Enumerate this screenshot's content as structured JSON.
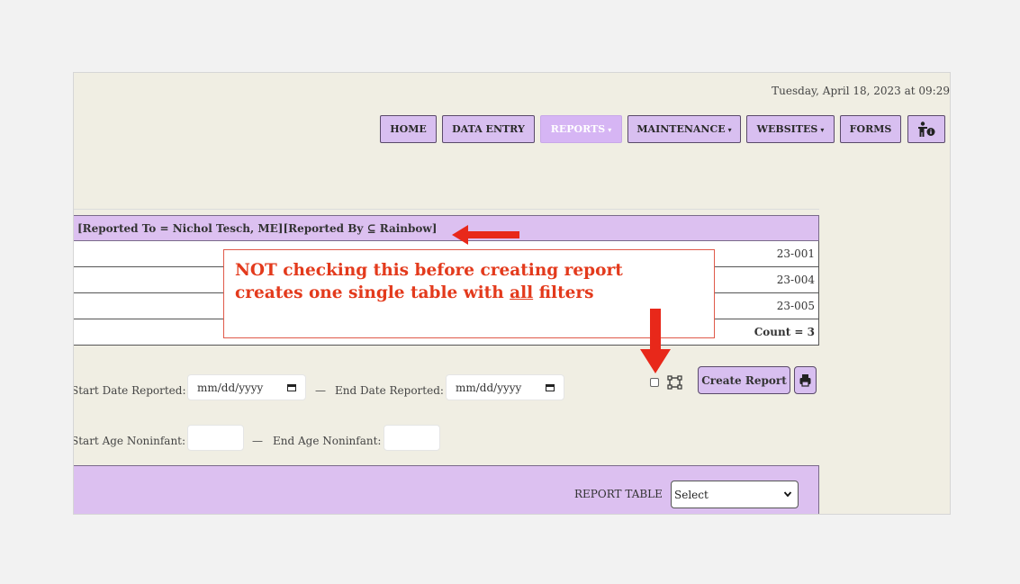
{
  "datetime": "Tuesday, April 18, 2023 at 09:29",
  "nav": {
    "home": "HOME",
    "data_entry": "DATA ENTRY",
    "reports": "REPORTS",
    "maintenance": "MAINTENANCE",
    "websites": "WEBSITES",
    "forms": "FORMS",
    "dropdown_caret": "▾"
  },
  "table": {
    "header": "[Reported To = Nichol Tesch, ME][Reported By ⊆ Rainbow]",
    "rows": [
      "23-001",
      "23-004",
      "23-005"
    ],
    "count": "Count = 3"
  },
  "callout": {
    "line1": "NOT checking this before creating report",
    "line2_pre": "creates one single table with ",
    "line2_under": "all",
    "line2_post": " filters"
  },
  "filters": {
    "start_date_label": "Start Date Reported:",
    "end_date_label": "End Date Reported:",
    "date_placeholder": "mm/dd/yyyy",
    "dash": "—",
    "start_age_label": "Start Age Noninfant:",
    "end_age_label": "End Age Noninfant:"
  },
  "actions": {
    "create_report": "Create Report"
  },
  "report_table": {
    "label": "REPORT TABLE",
    "selected": "Select"
  },
  "colors": {
    "accent_purple": "#dcc0f0",
    "arrow_red": "#e8281a",
    "panel_bg": "#f0eee3"
  }
}
